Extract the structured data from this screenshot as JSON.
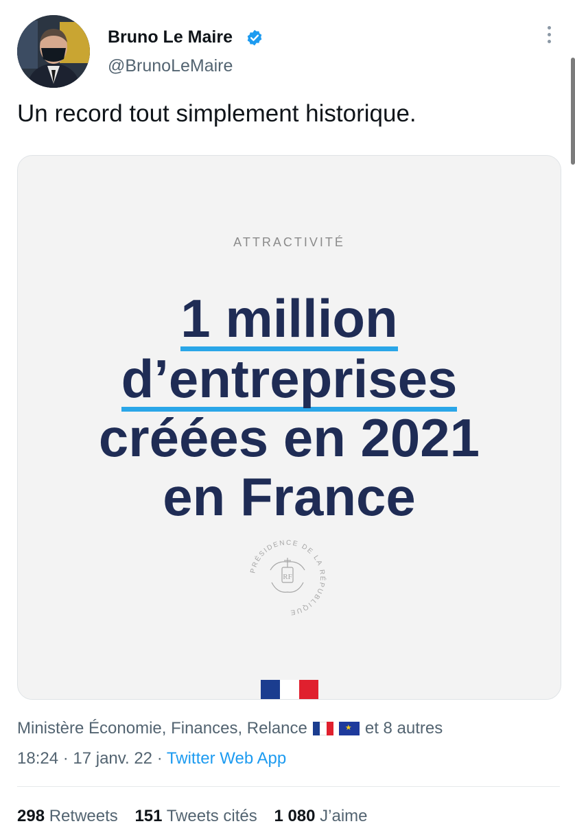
{
  "author": {
    "name": "Bruno Le Maire",
    "handle": "@BrunoLeMaire",
    "verified_icon": "verified-badge-icon"
  },
  "tweet": {
    "text": "Un record tout simplement historique."
  },
  "media": {
    "kicker": "ATTRACTIVITÉ",
    "headline_line1": "1 million",
    "headline_line2": "d’entreprises",
    "headline_line3": "créées en 2021",
    "headline_line4": "en France",
    "seal_text": "PRÉSIDENCE DE LA RÉPUBLIQUE",
    "seal_monogram": "RF",
    "colors": {
      "background": "#f3f3f3",
      "text": "#1f2c55",
      "underline": "#2aa6e8"
    },
    "flag_colors": [
      "#1b3d8f",
      "#ffffff",
      "#e0202e"
    ]
  },
  "meta": {
    "tagged": "Ministère Économie, Finances, Relance",
    "others": "et 8 autres",
    "time": "18:24 · 17 janv. 22 · ",
    "source": "Twitter Web App"
  },
  "stats": {
    "retweets_count": "298",
    "retweets_label": "Retweets",
    "quotes_count": "151",
    "quotes_label": "Tweets cités",
    "likes_count": "1 080",
    "likes_label": "J’aime"
  }
}
